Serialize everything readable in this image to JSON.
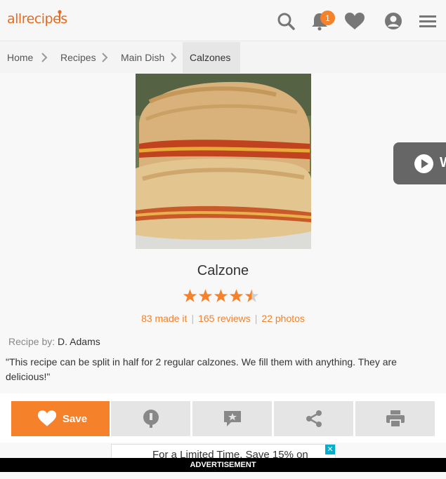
{
  "header": {
    "logo_text": "allrecipes",
    "notification_count": "1",
    "icons": [
      "search-icon",
      "bell-icon",
      "heart-icon",
      "profile-icon",
      "menu-icon"
    ]
  },
  "breadcrumb": {
    "items": [
      {
        "label": "Home"
      },
      {
        "label": "Recipes"
      },
      {
        "label": "Main Dish"
      }
    ],
    "current": "Calzones"
  },
  "video": {
    "label_partial": "W"
  },
  "recipe": {
    "title": "Calzone",
    "rating": 4.5,
    "made_it": "83 made it",
    "reviews": "165 reviews",
    "photos": "22 photos",
    "by_label": "Recipe by:",
    "author": "D. Adams",
    "description": "\"This recipe can be split in half for 2 regular calzones. We fill them with anything. They are delicious!\""
  },
  "actions": {
    "save_label": "Save",
    "buttons": [
      "tip-icon",
      "review-icon",
      "share-icon",
      "print-icon"
    ]
  },
  "ad": {
    "text": "For a Limited Time, Save 15% on",
    "close": "✕",
    "bar_label": "ADVERTISEMENT"
  },
  "colors": {
    "accent": "#f5812a",
    "video_bg": "#666666"
  }
}
